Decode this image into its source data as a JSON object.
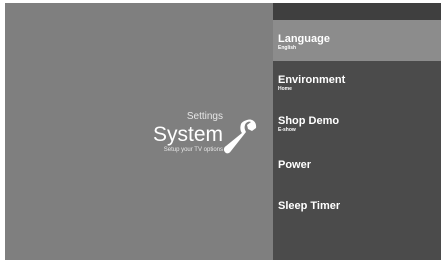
{
  "header": {
    "breadcrumb": "Settings",
    "title": "System",
    "subtitle": "Setup your TV options",
    "icon": "wrench-icon"
  },
  "menu": {
    "items": [
      {
        "label": "Language",
        "value": "English",
        "selected": true
      },
      {
        "label": "Environment",
        "value": "Home",
        "selected": false
      },
      {
        "label": "Shop Demo",
        "value": "E-show",
        "selected": false
      },
      {
        "label": "Power",
        "value": "",
        "selected": false
      },
      {
        "label": "Sleep Timer",
        "value": "",
        "selected": false
      }
    ]
  },
  "colors": {
    "background": "#7f7f7f",
    "menu_background": "#4b4b4b",
    "selected_background": "#8c8c8c",
    "text": "#ffffff"
  }
}
